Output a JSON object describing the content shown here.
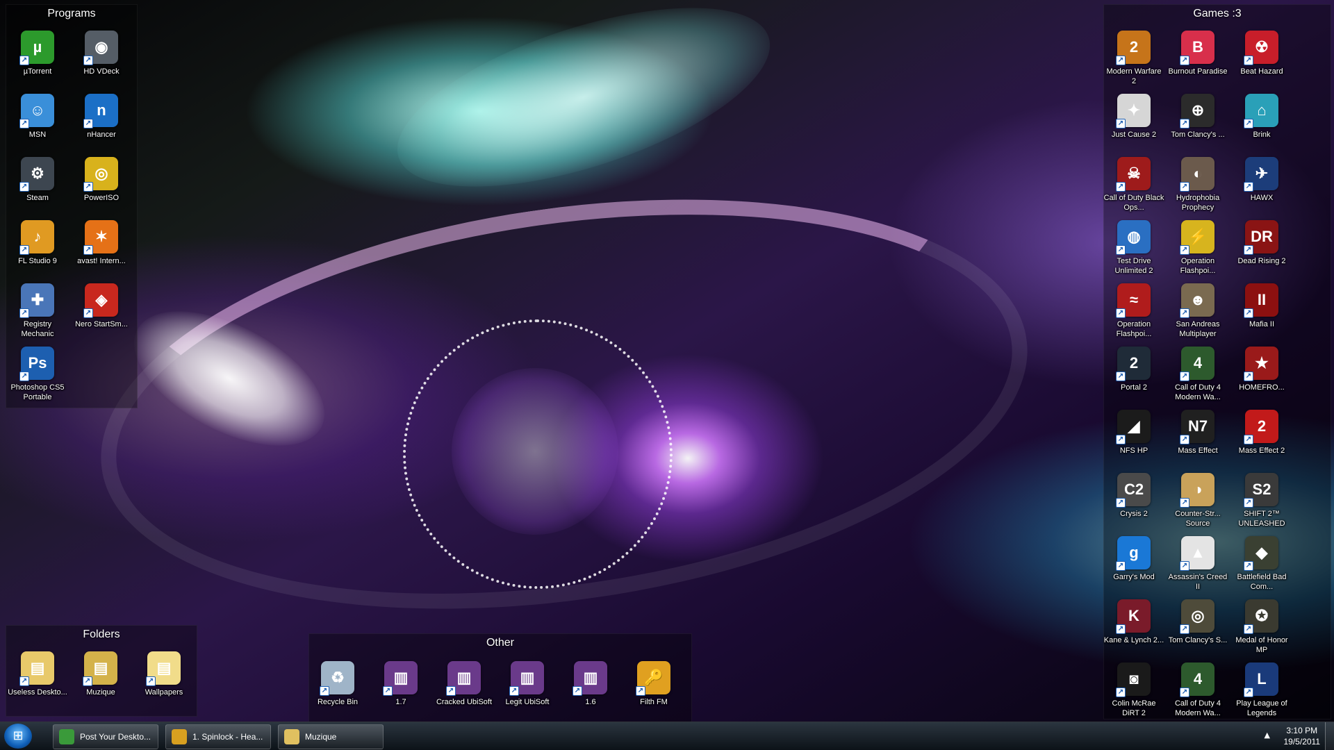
{
  "panels": {
    "programs": {
      "title": "Programs",
      "items": [
        {
          "label": "µTorrent",
          "color": "#2c9a2c",
          "glyph": "µ"
        },
        {
          "label": "HD VDeck",
          "color": "#555d66",
          "glyph": "◉"
        },
        {
          "label": "MSN",
          "color": "#3a8fd9",
          "glyph": "☺"
        },
        {
          "label": "nHancer",
          "color": "#1b6fc6",
          "glyph": "n"
        },
        {
          "label": "Steam",
          "color": "#3d4650",
          "glyph": "⚙"
        },
        {
          "label": "PowerISO",
          "color": "#d8b21c",
          "glyph": "◎"
        },
        {
          "label": "FL Studio 9",
          "color": "#e09a22",
          "glyph": "♪"
        },
        {
          "label": "avast! Intern...",
          "color": "#e57117",
          "glyph": "✶"
        },
        {
          "label": "Registry Mechanic",
          "color": "#4a76b8",
          "glyph": "✚"
        },
        {
          "label": "Nero StartSm...",
          "color": "#c8281e",
          "glyph": "◈"
        },
        {
          "label": "Photoshop CS5 Portable",
          "color": "#1d5fb0",
          "glyph": "Ps"
        }
      ]
    },
    "games": {
      "title": "Games :3",
      "items": [
        {
          "label": "Modern Warfare 2",
          "color": "#c6741a",
          "glyph": "2"
        },
        {
          "label": "Burnout Paradise",
          "color": "#d82f4b",
          "glyph": "B"
        },
        {
          "label": "Beat Hazard",
          "color": "#c81e2a",
          "glyph": "☢"
        },
        {
          "label": "Just Cause 2",
          "color": "#d6d6d6",
          "glyph": "✦"
        },
        {
          "label": "Tom Clancy's ...",
          "color": "#2b2b2b",
          "glyph": "⊕"
        },
        {
          "label": "Brink",
          "color": "#2aa0b8",
          "glyph": "⌂"
        },
        {
          "label": "Call of Duty Black Ops...",
          "color": "#9e1b1b",
          "glyph": "☠"
        },
        {
          "label": "Hydrophobia Prophecy",
          "color": "#6b5a4c",
          "glyph": "◐"
        },
        {
          "label": "HAWX",
          "color": "#1c3d7a",
          "glyph": "✈"
        },
        {
          "label": "Test Drive Unlimited 2",
          "color": "#2a6fc2",
          "glyph": "◍"
        },
        {
          "label": "Operation Flashpoi...",
          "color": "#d7b41e",
          "glyph": "⚡"
        },
        {
          "label": "Dead Rising 2",
          "color": "#8a1414",
          "glyph": "DR"
        },
        {
          "label": "Operation Flashpoi...",
          "color": "#b01c1c",
          "glyph": "≈"
        },
        {
          "label": "San Andreas Multiplayer",
          "color": "#7a6a50",
          "glyph": "☻"
        },
        {
          "label": "Mafia II",
          "color": "#8c1010",
          "glyph": "II"
        },
        {
          "label": "Portal 2",
          "color": "#1f2b38",
          "glyph": "2"
        },
        {
          "label": "Call of Duty 4 Modern Wa...",
          "color": "#2d5a2d",
          "glyph": "4"
        },
        {
          "label": "HOMEFRO...",
          "color": "#9a1a1a",
          "glyph": "★"
        },
        {
          "label": "NFS HP",
          "color": "#1b1b1b",
          "glyph": "◢"
        },
        {
          "label": "Mass Effect",
          "color": "#202020",
          "glyph": "N7"
        },
        {
          "label": "Mass Effect 2",
          "color": "#c21a1a",
          "glyph": "2"
        },
        {
          "label": "Crysis 2",
          "color": "#4a4a4a",
          "glyph": "C2"
        },
        {
          "label": "Counter-Str... Source",
          "color": "#c9a25a",
          "glyph": "◑"
        },
        {
          "label": "SHIFT 2™ UNLEASHED",
          "color": "#3a3a3a",
          "glyph": "S2"
        },
        {
          "label": "Garry's Mod",
          "color": "#1a78d6",
          "glyph": "g"
        },
        {
          "label": "Assassin's Creed II",
          "color": "#e4e4e4",
          "glyph": "▲"
        },
        {
          "label": "Battlefield Bad Com...",
          "color": "#3a4032",
          "glyph": "◆"
        },
        {
          "label": "Kane & Lynch 2...",
          "color": "#7a1b2a",
          "glyph": "K"
        },
        {
          "label": "Tom Clancy's S...",
          "color": "#4e4b3a",
          "glyph": "◎"
        },
        {
          "label": "Medal of Honor MP",
          "color": "#3a3a30",
          "glyph": "✪"
        },
        {
          "label": "Colin McRae DiRT 2",
          "color": "#1a1a1a",
          "glyph": "◙"
        },
        {
          "label": "Call of Duty 4 Modern Wa...",
          "color": "#2d5a2d",
          "glyph": "4"
        },
        {
          "label": "Play League of Legends",
          "color": "#1a3a7a",
          "glyph": "L"
        }
      ]
    },
    "folders": {
      "title": "Folders",
      "items": [
        {
          "label": "Useless Deskto...",
          "color": "#e8c96a",
          "glyph": "▤"
        },
        {
          "label": "Muzique",
          "color": "#d4b24a",
          "glyph": "▤"
        },
        {
          "label": "Wallpapers",
          "color": "#f1dc8a",
          "glyph": "▤"
        }
      ]
    },
    "other": {
      "title": "Other",
      "items": [
        {
          "label": "Recycle Bin",
          "color": "#9fb4c8",
          "glyph": "♻"
        },
        {
          "label": "1.7",
          "color": "#6a3a8a",
          "glyph": "▥"
        },
        {
          "label": "Cracked UbiSoft",
          "color": "#6a3a8a",
          "glyph": "▥"
        },
        {
          "label": "Legit UbiSoft",
          "color": "#6a3a8a",
          "glyph": "▥"
        },
        {
          "label": "1.6",
          "color": "#6a3a8a",
          "glyph": "▥"
        },
        {
          "label": "Filth FM",
          "color": "#e0a020",
          "glyph": "🔑"
        }
      ]
    }
  },
  "taskbar": {
    "items": [
      {
        "label": "Post Your Deskto...",
        "color": "#3a9a3a"
      },
      {
        "label": "1. Spinlock - Hea...",
        "color": "#d8a020"
      },
      {
        "label": "Muzique",
        "color": "#e0c060"
      }
    ],
    "time": "3:10 PM",
    "date": "19/5/2011",
    "tray_arrow": "▲"
  }
}
